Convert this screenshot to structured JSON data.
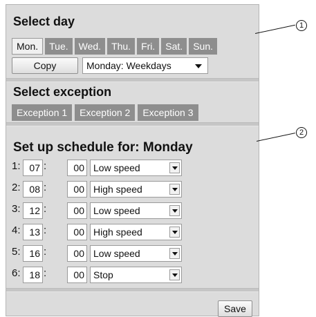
{
  "select_day": {
    "title": "Select day",
    "days": [
      "Mon.",
      "Tue.",
      "Wed.",
      "Thu.",
      "Fri.",
      "Sat.",
      "Sun."
    ],
    "active_day": "Mon.",
    "copy_label": "Copy",
    "copy_target": "Monday: Weekdays"
  },
  "select_exception": {
    "title": "Select exception",
    "exceptions": [
      "Exception 1",
      "Exception 2",
      "Exception 3"
    ]
  },
  "schedule": {
    "title": "Set up schedule for: Monday",
    "rows": [
      {
        "num": "1:",
        "hour": "07",
        "minute": "00",
        "mode": "Low speed"
      },
      {
        "num": "2:",
        "hour": "08",
        "minute": "00",
        "mode": "High speed"
      },
      {
        "num": "3:",
        "hour": "12",
        "minute": "00",
        "mode": "Low speed"
      },
      {
        "num": "4:",
        "hour": "13",
        "minute": "00",
        "mode": "High speed"
      },
      {
        "num": "5:",
        "hour": "16",
        "minute": "00",
        "mode": "Low speed"
      },
      {
        "num": "6:",
        "hour": "18",
        "minute": "00",
        "mode": "Stop"
      }
    ],
    "save_label": "Save"
  },
  "callouts": [
    "1",
    "2"
  ],
  "colors": {
    "panel_bg": "#dcdcdc",
    "tab_bg": "#8e8e8e",
    "tab_text": "#ffffff",
    "active_tab_bg": "#f0f0f0"
  }
}
